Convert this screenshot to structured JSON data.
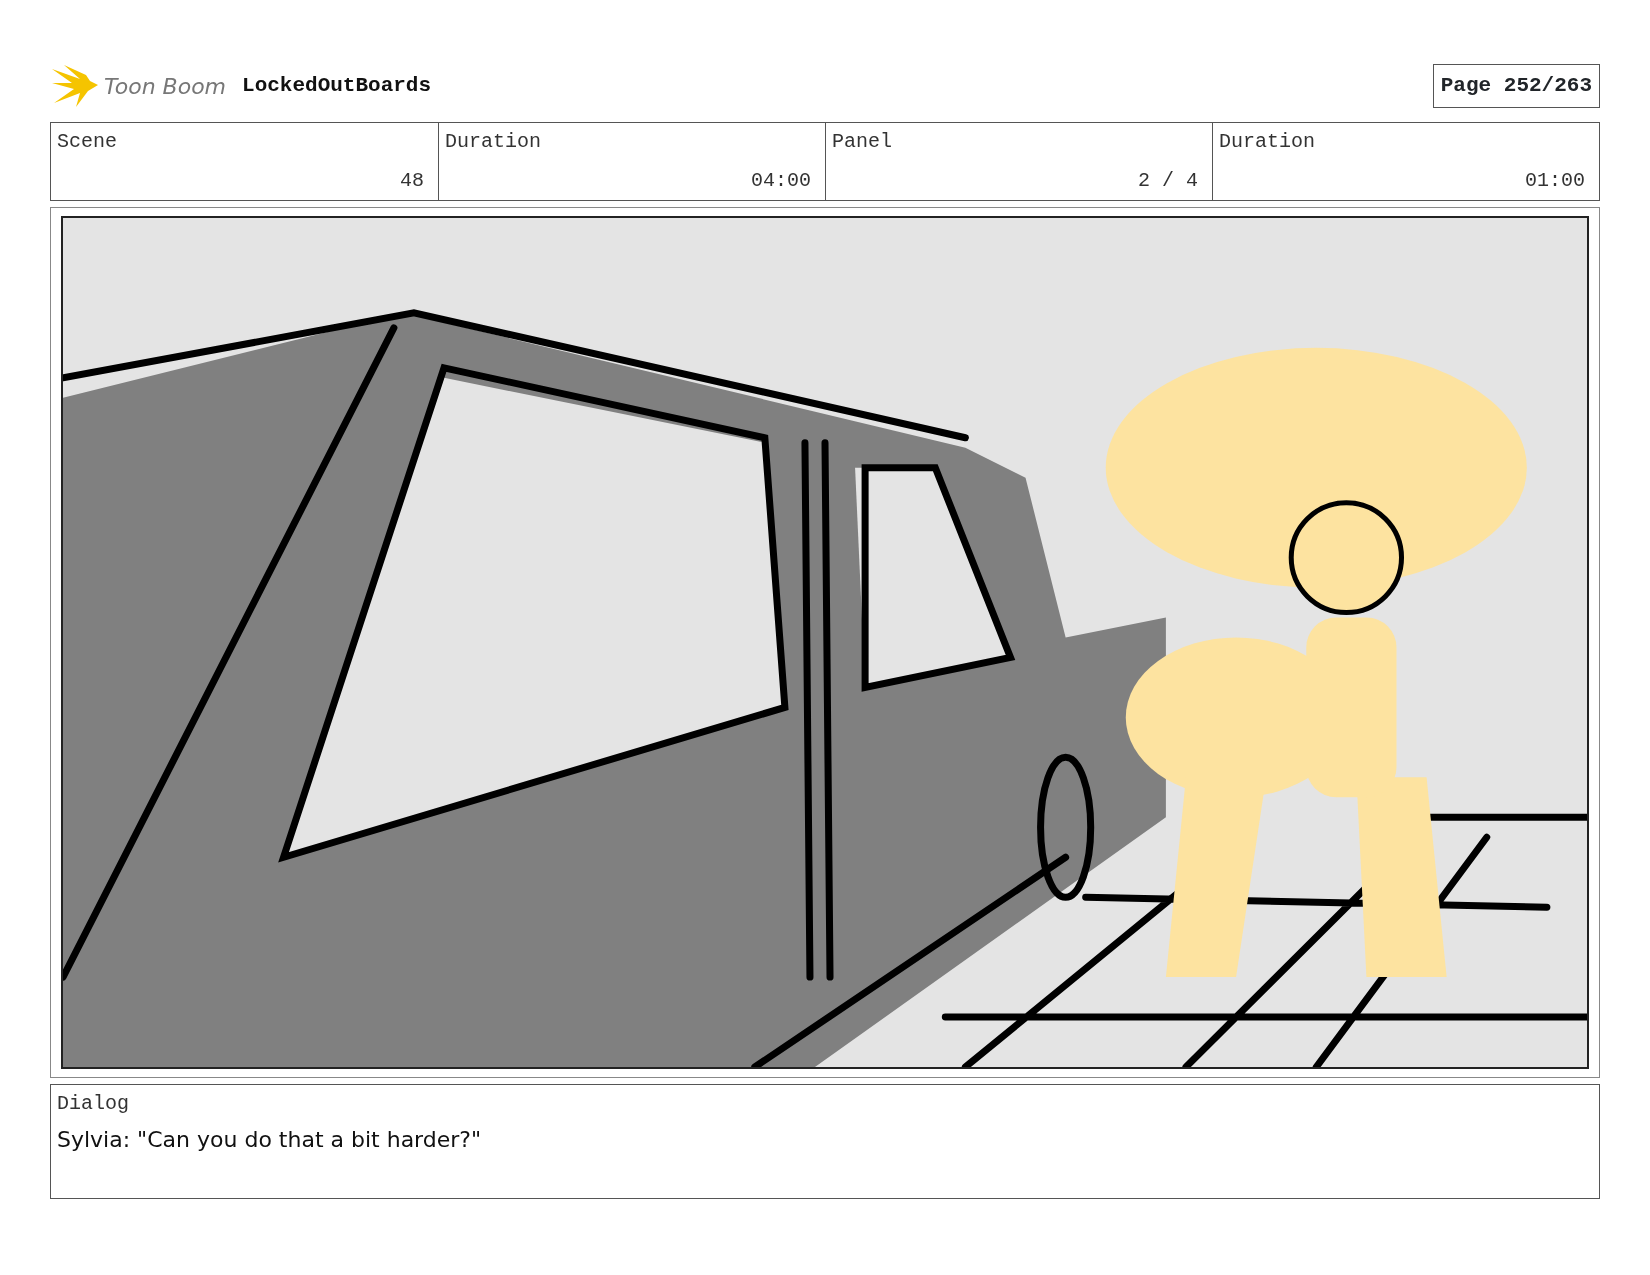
{
  "header": {
    "brand": "Toon Boom",
    "project": "LockedOutBoards",
    "page": "Page 252/263"
  },
  "info": [
    {
      "label": "Scene",
      "value": "48"
    },
    {
      "label": "Duration",
      "value": "04:00"
    },
    {
      "label": "Panel",
      "value": "2 / 4"
    },
    {
      "label": "Duration",
      "value": "01:00"
    }
  ],
  "dialog": {
    "label": "Dialog",
    "text": "Sylvia: \"Can you do that a bit harder?\""
  }
}
